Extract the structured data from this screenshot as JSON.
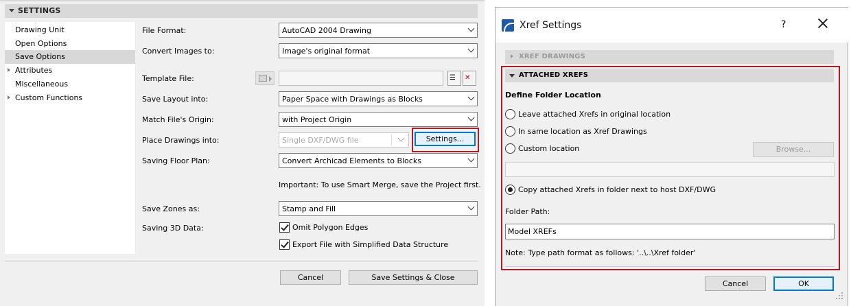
{
  "settings_panel": {
    "header": "SETTINGS",
    "nav_items": [
      {
        "label": "Drawing Unit",
        "selected": false,
        "expandable": false
      },
      {
        "label": "Open Options",
        "selected": false,
        "expandable": false
      },
      {
        "label": "Save Options",
        "selected": true,
        "expandable": false
      },
      {
        "label": "Attributes",
        "selected": false,
        "expandable": true
      },
      {
        "label": "Miscellaneous",
        "selected": false,
        "expandable": false
      },
      {
        "label": "Custom Functions",
        "selected": false,
        "expandable": true
      }
    ],
    "fields": {
      "file_format": {
        "label": "File Format:",
        "value": "AutoCAD 2004 Drawing"
      },
      "convert_images": {
        "label": "Convert Images to:",
        "value": "Image's original format"
      },
      "template_file": {
        "label": "Template File:",
        "value": ""
      },
      "save_layout": {
        "label": "Save Layout into:",
        "value": "Paper Space with Drawings as Blocks"
      },
      "match_origin": {
        "label": "Match File's Origin:",
        "value": "with Project Origin"
      },
      "place_drawings": {
        "label": "Place Drawings into:",
        "value": "Single DXF/DWG file",
        "settings_button": "Settings..."
      },
      "saving_floor_plan": {
        "label": "Saving Floor Plan:",
        "value": "Convert Archicad Elements to Blocks"
      },
      "save_zones": {
        "label": "Save Zones as:",
        "value": "Stamp and Fill"
      },
      "saving_3d": {
        "label": "Saving 3D Data:"
      }
    },
    "important_note": "Important: To use Smart Merge, save the Project first.",
    "checkboxes": [
      {
        "label": "Omit Polygon Edges",
        "checked": true
      },
      {
        "label": "Export File with Simplified Data Structure",
        "checked": true
      }
    ],
    "buttons": {
      "cancel": "Cancel",
      "save_close": "Save Settings & Close"
    }
  },
  "xref_dialog": {
    "title": "Xref Settings",
    "help": "?",
    "sections": {
      "xref_drawings": "XREF DRAWINGS",
      "attached_xrefs": "ATTACHED XREFS"
    },
    "define_folder_heading": "Define Folder Location",
    "radio_options": [
      {
        "label": "Leave attached Xrefs in original location",
        "checked": false
      },
      {
        "label": "In same location as Xref Drawings",
        "checked": false
      },
      {
        "label": "Custom location",
        "checked": false
      },
      {
        "label": "Copy attached Xrefs in folder next to host DXF/DWG",
        "checked": true
      }
    ],
    "browse_button": "Browse...",
    "folder_path_label": "Folder Path:",
    "folder_path_value": "Model XREFs",
    "path_note": "Note: Type path format as follows:   '..\\..\\Xref folder'",
    "buttons": {
      "cancel": "Cancel",
      "ok": "OK"
    }
  },
  "colors": {
    "highlight_border": "#b31b24",
    "focus_blue": "#0078d7",
    "panel_bg": "#f0f0f0",
    "section_bg": "#d9d9d9"
  }
}
